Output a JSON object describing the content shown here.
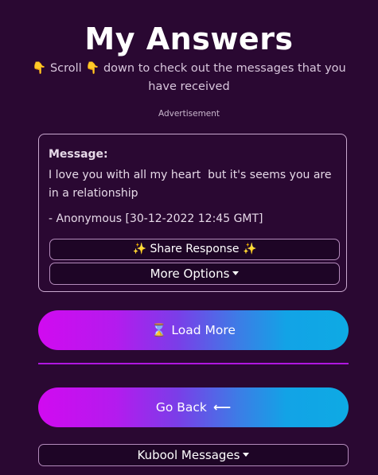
{
  "header": {
    "title": "My Answers",
    "subtitle": "👇 Scroll 👇 down to check out the messages that you have received",
    "ad_label": "Advertisement"
  },
  "message_card": {
    "heading": "Message:",
    "body": "I love you with all my heart  but it's seems you are in a relationship",
    "author": "- Anonymous [30-12-2022 12:45 GMT]",
    "share_label": "✨ Share Response ✨",
    "more_options_label": "More Options"
  },
  "actions": {
    "load_more_icon": "⌛",
    "load_more_label": "Load More",
    "go_back_label": "Go Back",
    "go_back_icon": "⟵",
    "kubool_label": "Kubool Messages"
  },
  "colors": {
    "background": "#2a0832",
    "gradient_start": "#d10af0",
    "gradient_end": "#0eaae4",
    "divider": "#b017e0"
  }
}
